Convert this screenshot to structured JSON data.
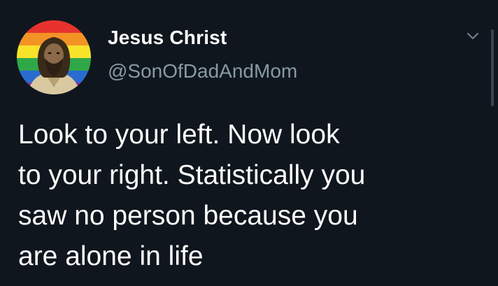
{
  "author": {
    "name": "Jesus Christ",
    "handle": "@SonOfDadAndMom",
    "avatar_icon": "rainbow-jesus-avatar"
  },
  "menu": {
    "icon": "chevron-down-icon"
  },
  "tweet": {
    "lines": [
      "Look to your left. Now look",
      "to your right. Statistically you",
      "saw no person because you",
      "are alone in life"
    ]
  },
  "colors": {
    "background": "#10161d",
    "text": "#ffffff",
    "secondary_text": "#8899a6"
  }
}
